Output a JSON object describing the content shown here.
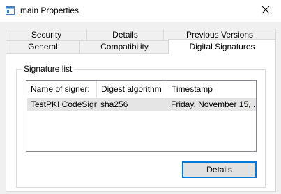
{
  "window": {
    "title": "main Properties",
    "icon": "properties-window-icon"
  },
  "titlebar": {
    "close_icon": "close-icon"
  },
  "tabs": {
    "row1": [
      {
        "label": "Security"
      },
      {
        "label": "Details"
      },
      {
        "label": "Previous Versions"
      }
    ],
    "row2": [
      {
        "label": "General"
      },
      {
        "label": "Compatibility"
      },
      {
        "label": "Digital Signatures",
        "selected": true
      }
    ]
  },
  "signature_group": {
    "label": "Signature list",
    "columns": [
      "Name of signer:",
      "Digest algorithm",
      "Timestamp"
    ],
    "rows": [
      {
        "signer": "TestPKI CodeSign",
        "digest": "sha256",
        "timestamp": "Friday, November 15, ..."
      }
    ]
  },
  "buttons": {
    "details_label": "Details"
  },
  "colors": {
    "accent": "#0078d7",
    "dialog_bg": "#f0f0f0",
    "row_selected_bg": "#e5e5e5"
  }
}
